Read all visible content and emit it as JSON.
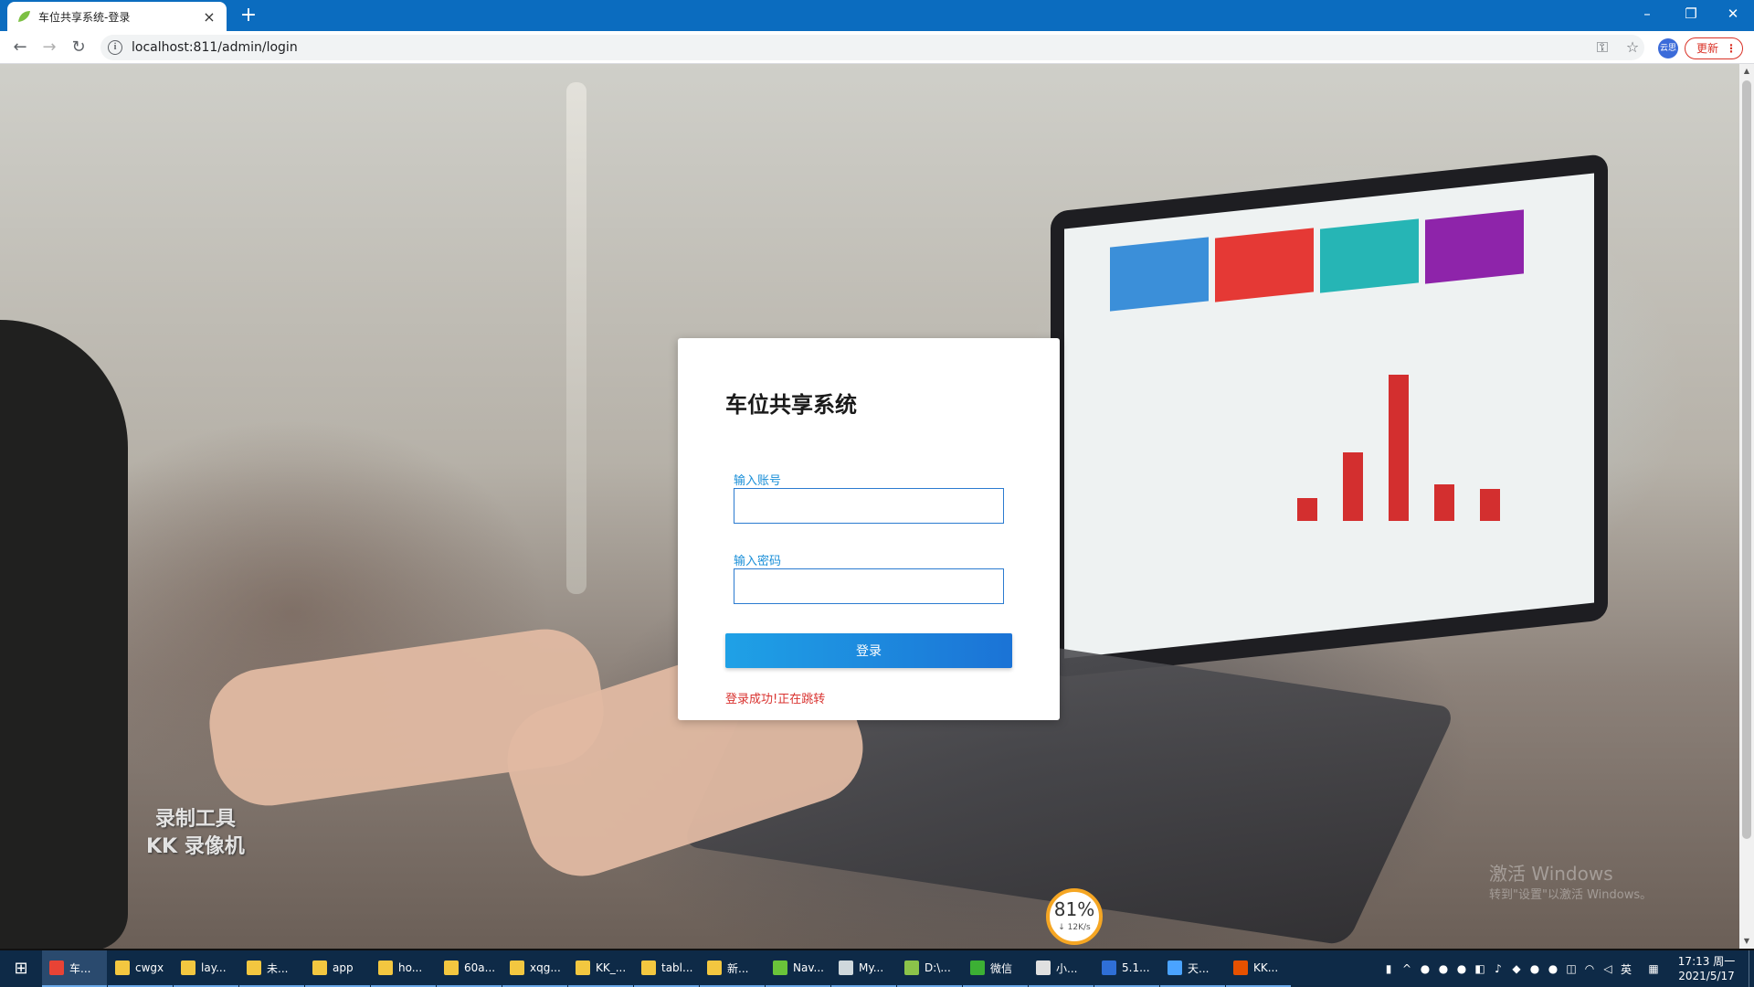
{
  "browser": {
    "tab_title": "车位共享系统-登录",
    "tab_close": "×",
    "new_tab": "+",
    "url": "localhost:811/admin/login",
    "profile_label": "云思",
    "update_label": "更新"
  },
  "window_controls": {
    "minimize": "–",
    "restore": "❐",
    "close": "✕"
  },
  "login": {
    "system_title": "车位共享系统",
    "account_label": "输入账号",
    "account_value": "",
    "password_label": "输入密码",
    "password_value": "",
    "submit_label": "登录",
    "status_message": "登录成功!正在跳转"
  },
  "overlays": {
    "recorder_line1": "录制工具",
    "recorder_line2": "KK 录像机",
    "activate_title": "激活 Windows",
    "activate_sub": "转到\"设置\"以激活 Windows。",
    "speed_percent": "81%",
    "speed_rate": "↓ 12K/s"
  },
  "taskbar": {
    "items": [
      {
        "label": "车...",
        "color": "#e84335"
      },
      {
        "label": "cwgx",
        "color": "#f3c740"
      },
      {
        "label": "lay...",
        "color": "#f3c740"
      },
      {
        "label": "未...",
        "color": "#f3c740"
      },
      {
        "label": "app",
        "color": "#f3c740"
      },
      {
        "label": "ho...",
        "color": "#f3c740"
      },
      {
        "label": "60a...",
        "color": "#f3c740"
      },
      {
        "label": "xqg...",
        "color": "#f3c740"
      },
      {
        "label": "KK_...",
        "color": "#f3c740"
      },
      {
        "label": "tabl...",
        "color": "#f3c740"
      },
      {
        "label": "新...",
        "color": "#f3c740"
      },
      {
        "label": "Nav...",
        "color": "#6ac43a"
      },
      {
        "label": "My...",
        "color": "#cfd8dc"
      },
      {
        "label": "D:\\...",
        "color": "#8bc34a"
      },
      {
        "label": "微信",
        "color": "#3cb034"
      },
      {
        "label": "小...",
        "color": "#e0e0e0"
      },
      {
        "label": "5.1...",
        "color": "#2f6fd6"
      },
      {
        "label": "天...",
        "color": "#4aa3ff"
      },
      {
        "label": "KK...",
        "color": "#e65100"
      }
    ],
    "ime": "英",
    "time": "17:13 周一",
    "date": "2021/5/17"
  }
}
